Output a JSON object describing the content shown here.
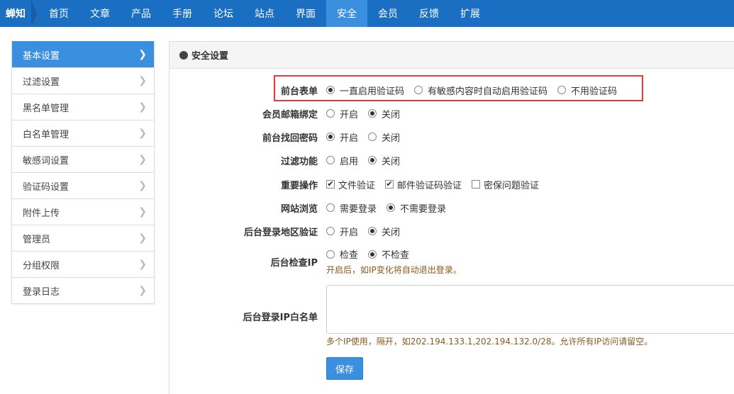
{
  "brand": "蝉知",
  "nav": [
    "首页",
    "文章",
    "产品",
    "手册",
    "论坛",
    "站点",
    "界面",
    "安全",
    "会员",
    "反馈",
    "扩展"
  ],
  "nav_active": 7,
  "sidebar": {
    "items": [
      "基本设置",
      "过滤设置",
      "黑名单管理",
      "白名单管理",
      "敏感词设置",
      "验证码设置",
      "附件上传",
      "管理员",
      "分组权限",
      "登录日志"
    ],
    "active": 0
  },
  "panel": {
    "title": "安全设置"
  },
  "form": {
    "captcha": {
      "label": "前台表单",
      "options": [
        "一直启用验证码",
        "有敏感内容时自动启用验证码",
        "不用验证码"
      ],
      "selected": 0
    },
    "email_bind": {
      "label": "会员邮箱绑定",
      "options": [
        "开启",
        "关闭"
      ],
      "selected": 1
    },
    "find_password": {
      "label": "前台找回密码",
      "options": [
        "开启",
        "关闭"
      ],
      "selected": 0
    },
    "filter": {
      "label": "过滤功能",
      "options": [
        "启用",
        "关闭"
      ],
      "selected": 1
    },
    "important_ops": {
      "label": "重要操作",
      "options": [
        "文件验证",
        "邮件验证码验证",
        "密保问题验证"
      ],
      "checked": [
        true,
        true,
        false
      ]
    },
    "site_browse": {
      "label": "网站浏览",
      "options": [
        "需要登录",
        "不需要登录"
      ],
      "selected": 1
    },
    "login_region": {
      "label": "后台登录地区验证",
      "options": [
        "开启",
        "关闭"
      ],
      "selected": 1
    },
    "check_ip": {
      "label": "后台检查IP",
      "options": [
        "检查",
        "不检查"
      ],
      "selected": 1,
      "help": "开启后，如IP变化将自动退出登录。"
    },
    "ip_whitelist": {
      "label": "后台登录IP白名单",
      "value": "",
      "help": "多个IP使用，隔开，如202.194.133.1,202.194.132.0/28。允许所有IP访问请留空。"
    },
    "save_label": "保存"
  }
}
